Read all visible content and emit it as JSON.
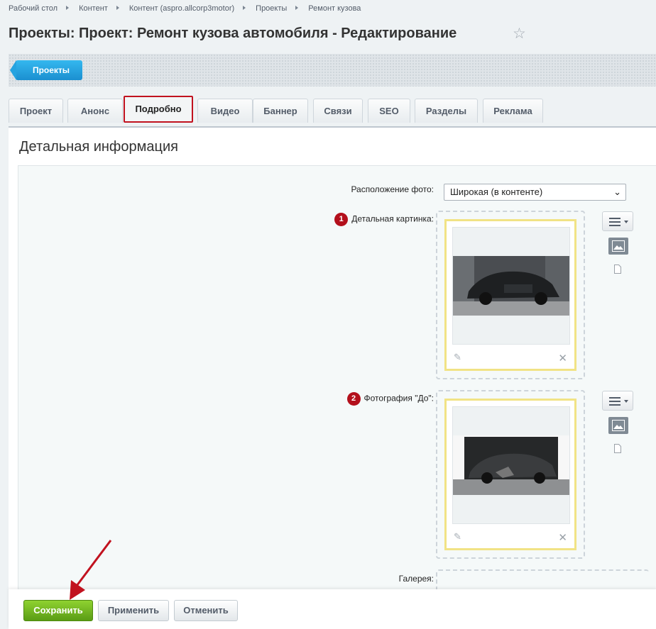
{
  "breadcrumb": [
    "Рабочий стол",
    "Контент",
    "Контент (aspro.allcorp3motor)",
    "Проекты",
    "Ремонт кузова"
  ],
  "page": {
    "title": "Проекты: Проект: Ремонт кузова автомобиля - Редактирование",
    "favorite_icon": "star-icon"
  },
  "toolbar": {
    "back_label": "Проекты"
  },
  "tabs": [
    {
      "label": "Проект"
    },
    {
      "label": "Анонс"
    },
    {
      "label": "Подробно",
      "active": true
    },
    {
      "label": "Видео"
    },
    {
      "label": "Баннер"
    },
    {
      "label": "Связи"
    },
    {
      "label": "SEO"
    },
    {
      "label": "Разделы"
    },
    {
      "label": "Реклама"
    }
  ],
  "section": {
    "title": "Детальная информация"
  },
  "fields": {
    "photo_position": {
      "label": "Расположение фото:",
      "value": "Широкая (в контенте)"
    },
    "detail_image": {
      "badge": "1",
      "label": "Детальная картинка:"
    },
    "before_photo": {
      "badge": "2",
      "label": "Фотография \"До\":"
    },
    "gallery": {
      "label": "Галерея:"
    }
  },
  "actions": {
    "save": "Сохранить",
    "apply": "Применить",
    "cancel": "Отменить"
  },
  "colors": {
    "accent": "#1b8fd0",
    "save": "#5a9c14",
    "highlight": "#c1121f",
    "badge": "#b3101c"
  }
}
